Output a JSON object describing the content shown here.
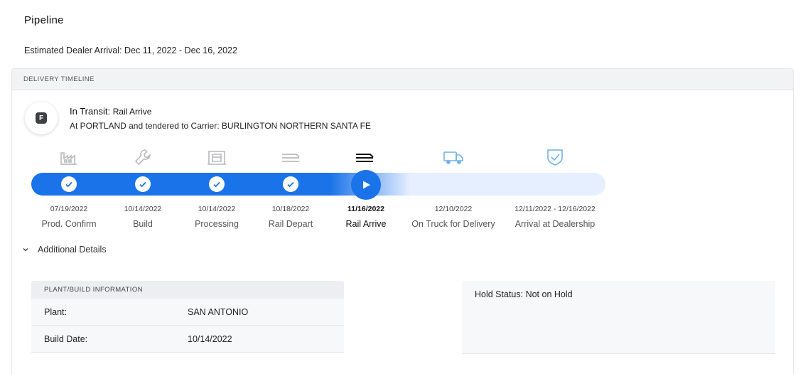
{
  "page": {
    "title": "Pipeline",
    "estimated_arrival": "Estimated Dealer Arrival: Dec 11, 2022 - Dec 16, 2022"
  },
  "timeline": {
    "header": "DELIVERY TIMELINE",
    "status_letter": "F",
    "status_label": "In Transit: ",
    "status_value": "Rail Arrive",
    "status_detail": "At PORTLAND and tendered to Carrier: BURLINGTON NORTHERN SANTA FE",
    "current_step_index": 4,
    "steps": [
      {
        "date": "07/19/2022",
        "label": "Prod. Confirm",
        "icon": "factory-icon",
        "state": "complete"
      },
      {
        "date": "10/14/2022",
        "label": "Build",
        "icon": "wrench-icon",
        "state": "complete"
      },
      {
        "date": "10/14/2022",
        "label": "Processing",
        "icon": "processing-icon",
        "state": "complete"
      },
      {
        "date": "10/18/2022",
        "label": "Rail Depart",
        "icon": "rail-car-icon",
        "state": "complete"
      },
      {
        "date": "11/16/2022",
        "label": "Rail Arrive",
        "icon": "rail-car-icon",
        "state": "current"
      },
      {
        "date": "12/10/2022",
        "label": "On Truck for Delivery",
        "icon": "truck-icon",
        "state": "upcoming"
      },
      {
        "date": "12/11/2022 - 12/16/2022",
        "label": "Arrival at Dealership",
        "icon": "shield-check-icon",
        "state": "upcoming"
      }
    ]
  },
  "details": {
    "toggle_label": "Additional Details",
    "plant": {
      "header": "PLANT/BUILD INFORMATION",
      "rows": [
        {
          "key": "Plant:",
          "value": "SAN ANTONIO"
        },
        {
          "key": "Build Date:",
          "value": "10/14/2022"
        }
      ]
    },
    "hold_status": "Hold Status: Not on Hold"
  },
  "colors": {
    "accent": "#1a73e8",
    "track_upcoming": "#e6efff",
    "icon_complete": "#b7b9bd",
    "icon_upcoming": "#6fb2e6",
    "icon_current": "#111111"
  }
}
